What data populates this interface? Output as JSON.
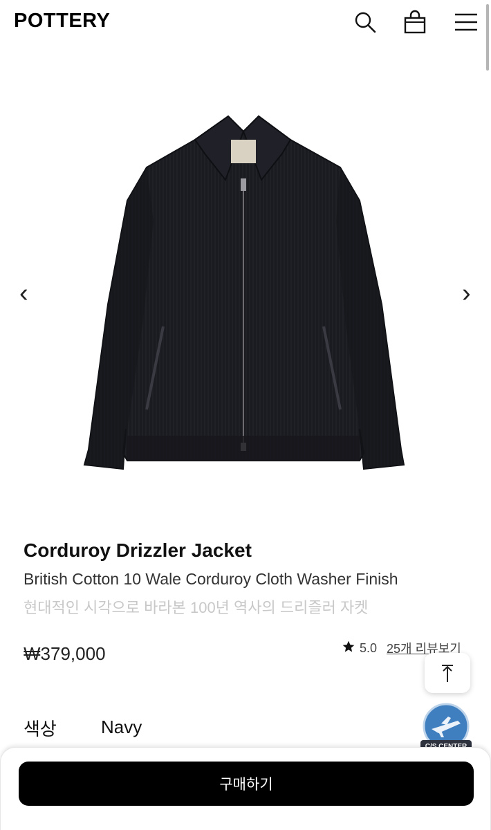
{
  "header": {
    "logo": "POTTERY",
    "icons": [
      "search-icon",
      "shopping-bag-icon",
      "menu-icon"
    ]
  },
  "gallery": {
    "prev_label": "‹",
    "next_label": "›"
  },
  "product": {
    "name": "Corduroy Drizzler Jacket",
    "subtitle": "British Cotton 10 Wale Corduroy Cloth Washer Finish",
    "description": "현대적인 시각으로 바라본 100년 역사의 드리즐러 자켓",
    "price": "₩379,000",
    "rating": "5.0",
    "reviews_link": "25개 리뷰보기",
    "color_label": "색상",
    "color_value": "Navy"
  },
  "floating": {
    "cs_label": "C/S CENTER"
  },
  "bottom_bar": {
    "buy_label": "구매하기"
  },
  "colors": {
    "jacket": "#17181e",
    "buy_button": "#000000",
    "cs_globe": "#3f7fc0"
  }
}
